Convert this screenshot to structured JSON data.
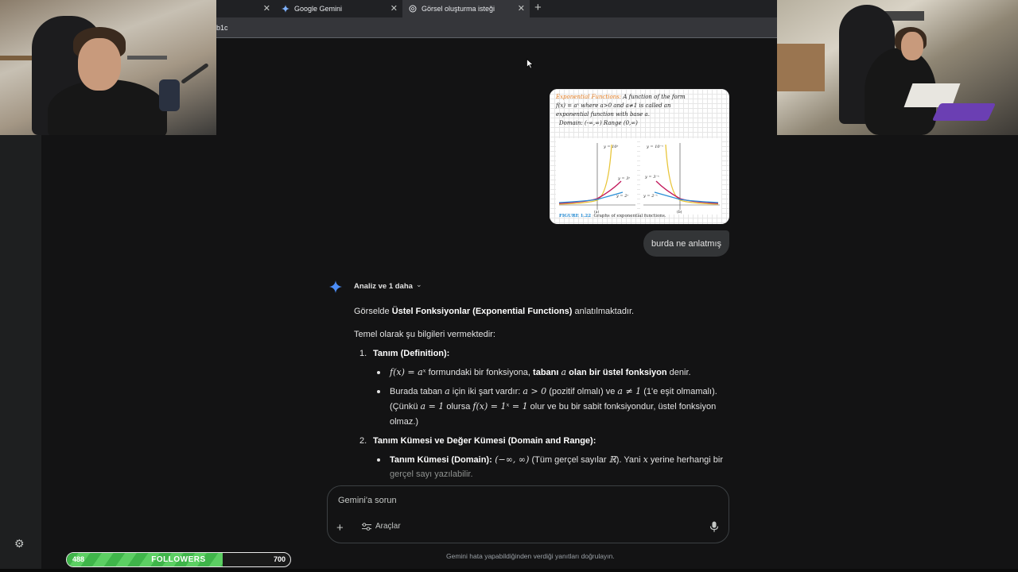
{
  "browser": {
    "tabs": [
      {
        "title": "Google Gemini",
        "icon": "gemini-icon",
        "active": false
      },
      {
        "title": "Görsel oluşturma isteği",
        "icon": "chatgpt-icon",
        "active": true
      }
    ],
    "url_fragment": "b1c"
  },
  "chat": {
    "user_image": {
      "handwriting": {
        "line1_title": "Exponential Functions:",
        "line1_rest": "A function of the form",
        "line2": "f(x) = aˣ   where   a>0 and   a≠1  is called an",
        "line3": "exponential function with base a.",
        "line4": "Domain: (-∞,∞)        Range (0,∞)"
      },
      "graph_labels": {
        "a_top": "y = 10ˣ",
        "a_mid": "y = 3ˣ",
        "a_low": "y = 2ˣ",
        "b_top": "y = 10⁻ˣ",
        "b_mid": "y = 3⁻ˣ",
        "b_low": "y = 2⁻ˣ",
        "panel_a": "(a)",
        "panel_b": "(b)"
      },
      "figure_number": "FIGURE 1.22",
      "figure_caption": "Graphs of exponential functions."
    },
    "user_prompt": "burda ne anlatmış",
    "response": {
      "header": "Analiz ve 1 daha",
      "intro_pre": "Görselde ",
      "intro_bold": "Üstel Fonksiyonlar (Exponential Functions)",
      "intro_post": " anlatılmaktadır.",
      "lead": "Temel olarak şu bilgileri vermektedir:",
      "item1_num": "1.",
      "item1_title": "Tanım (Definition):",
      "b1_math": "f(x) = aˣ",
      "b1_text": " formundaki bir fonksiyona, ",
      "b1_bold1": "tabanı ",
      "b1_math2": "a",
      "b1_bold2": " olan bir üstel fonksiyon",
      "b1_end": " denir.",
      "b2_l1_a": "Burada taban ",
      "b2_l1_math": "a",
      "b2_l1_b": " için iki şart vardır: ",
      "b2_l1_math2": "a > 0",
      "b2_l1_c": " (pozitif olmalı) ve ",
      "b2_l1_math3": "a ≠ 1",
      "b2_l1_d": " (1'e eşit olmamalı).",
      "b2_l2_a": "(Çünkü ",
      "b2_l2_math": "a = 1",
      "b2_l2_b": " olursa ",
      "b2_l2_math2": "f(x) = 1ˣ = 1",
      "b2_l2_c": " olur ve bu bir sabit fonksiyondur, üstel fonksiyon",
      "b2_l3": "olmaz.)",
      "item2_num": "2.",
      "item2_title": "Tanım Kümesi ve Değer Kümesi (Domain and Range):",
      "b3_bold": "Tanım Kümesi (Domain):",
      "b3_math": " (−∞, ∞)",
      "b3_text": " (Tüm gerçel sayılar ",
      "b3_math2": "ℝ",
      "b3_text2": "). Yani ",
      "b3_math3": "x",
      "b3_text3": " yerine herhangi bir",
      "b3_l2": "gerçel sayı yazılabilir."
    }
  },
  "input": {
    "placeholder": "Gemini'a sorun",
    "tools_label": "Araçlar",
    "disclaimer": "Gemini hata yapabildiğinden verdiği yanıtları doğrulayın."
  },
  "followers_widget": {
    "current": "488",
    "label": "FOLLOWERS",
    "goal": "700",
    "progress_fraction": 0.697
  },
  "colors": {
    "background": "#131314",
    "accent": "#4c8df6",
    "progress": "#3fb54a"
  }
}
